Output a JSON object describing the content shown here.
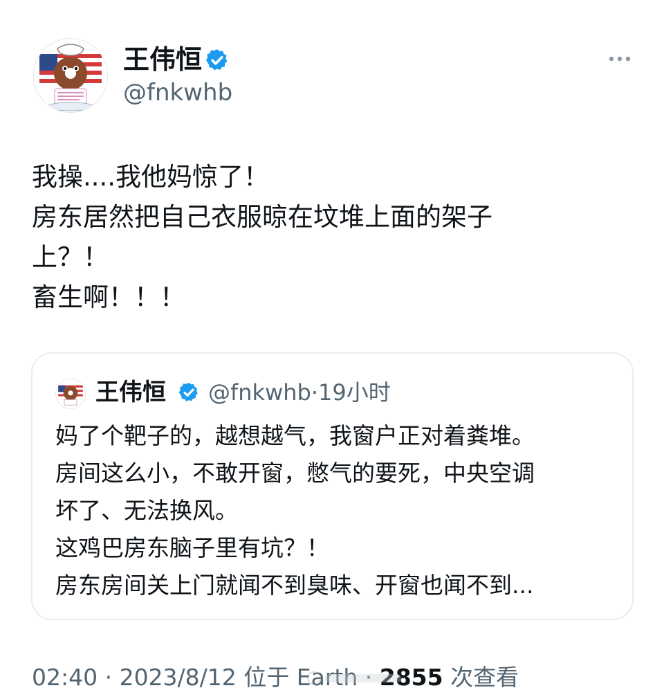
{
  "tweet": {
    "author": {
      "display_name": "王伟恒",
      "handle": "@fnkwhb",
      "avatar_icon": "donut-cartoon-avatar",
      "verified_icon": "verified-badge-icon"
    },
    "more_icon": "more-horizontal-icon",
    "text": "我操....我他妈惊了！\n房东居然把自己衣服晾在坟堆上面的架子\n上？！\n畜生啊！！！",
    "timestamp": "02:40 · 2023/8/12",
    "location": "位于 Earth",
    "views_count": "2855",
    "views_label": "次查看"
  },
  "quoted_tweet": {
    "display_name": "王伟恒",
    "handle": "@fnkwhb",
    "time_ago": "19小时",
    "text": "妈了个靶子的，越想越气，我窗户正对着粪堆。\n房间这么小，不敢开窗，憋气的要死，中央空调\n坏了、无法换风。\n这鸡巴房东脑子里有坑？！\n房东房间关上门就闻不到臭味、开窗也闻不到..."
  },
  "colors": {
    "text_primary": "#0f1419",
    "text_secondary": "#536471",
    "verified_blue": "#1d9bf0",
    "card_border": "#e8ecef"
  }
}
